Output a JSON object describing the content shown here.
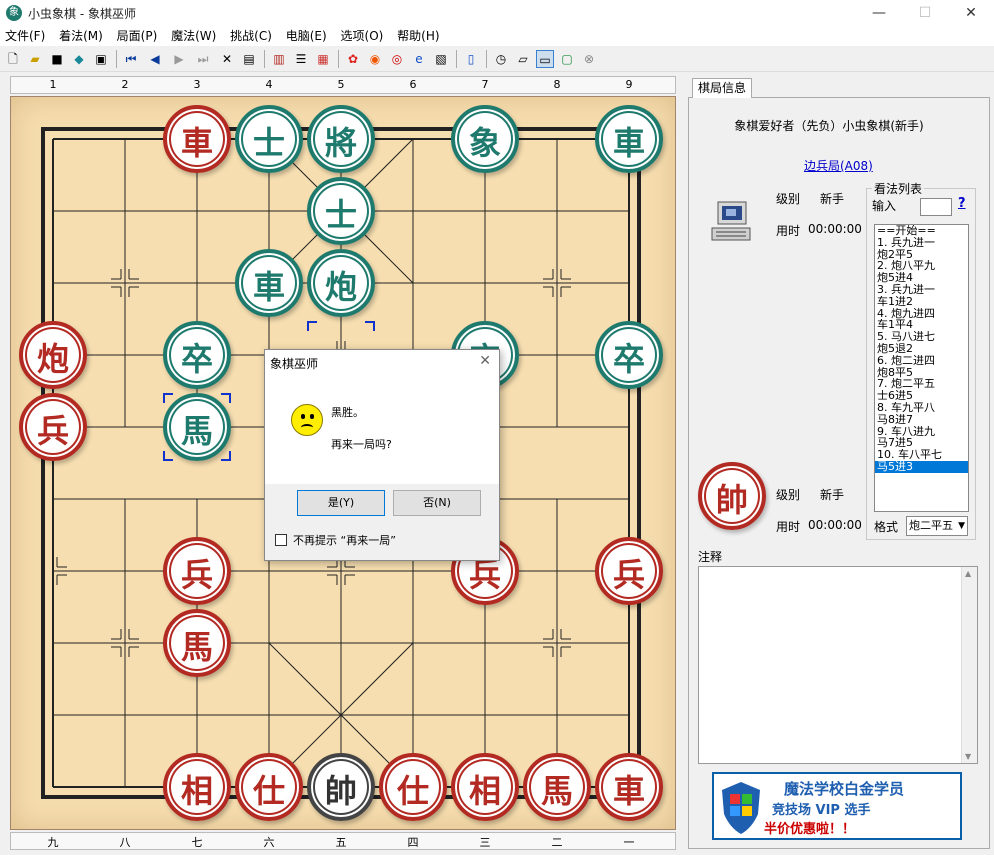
{
  "window": {
    "title": "小虫象棋 - 象棋巫师",
    "app_icon_char": "象",
    "controls": {
      "minimize": "—",
      "maximize": "☐",
      "close": "✕"
    }
  },
  "menu": [
    "文件(F)",
    "着法(M)",
    "局面(P)",
    "魔法(W)",
    "挑战(C)",
    "电脑(E)",
    "选项(O)",
    "帮助(H)"
  ],
  "toolbar_icons": [
    "new-file-icon",
    "open-folder-icon",
    "save-icon",
    "edit-board-icon",
    "print-icon",
    "first-move-icon",
    "prev-move-icon",
    "next-move-icon",
    "last-move-icon",
    "delete-icon",
    "paste-icon",
    "book-icon",
    "tree-icon",
    "table-icon",
    "network-icon",
    "weibo-icon",
    "ie-icon",
    "notes-icon",
    "library-icon",
    "clock-icon",
    "stack-icon",
    "computer-icon",
    "monitor-icon",
    "stop-icon"
  ],
  "board": {
    "top_files": [
      "1",
      "2",
      "3",
      "4",
      "5",
      "6",
      "7",
      "8",
      "9"
    ],
    "bottom_files": [
      "九",
      "八",
      "七",
      "六",
      "五",
      "四",
      "三",
      "二",
      "一"
    ],
    "pieces": [
      {
        "char": "車",
        "side": "red",
        "col": 2,
        "row": 0
      },
      {
        "char": "士",
        "side": "green",
        "col": 3,
        "row": 0
      },
      {
        "char": "將",
        "side": "green",
        "col": 4,
        "row": 0
      },
      {
        "char": "象",
        "side": "green",
        "col": 6,
        "row": 0
      },
      {
        "char": "車",
        "side": "green",
        "col": 8,
        "row": 0
      },
      {
        "char": "士",
        "side": "green",
        "col": 4,
        "row": 1
      },
      {
        "char": "車",
        "side": "green",
        "col": 3,
        "row": 2
      },
      {
        "char": "炮",
        "side": "green",
        "col": 4,
        "row": 2
      },
      {
        "char": "炮",
        "side": "red",
        "col": 0,
        "row": 3
      },
      {
        "char": "卒",
        "side": "green",
        "col": 2,
        "row": 3
      },
      {
        "char": "卒",
        "side": "green",
        "col": 6,
        "row": 3
      },
      {
        "char": "卒",
        "side": "green",
        "col": 8,
        "row": 3
      },
      {
        "char": "兵",
        "side": "red",
        "col": 0,
        "row": 4
      },
      {
        "char": "馬",
        "side": "green",
        "col": 2,
        "row": 4
      },
      {
        "char": "兵",
        "side": "red",
        "col": 2,
        "row": 6
      },
      {
        "char": "兵",
        "side": "red",
        "col": 6,
        "row": 6
      },
      {
        "char": "兵",
        "side": "red",
        "col": 8,
        "row": 6
      },
      {
        "char": "馬",
        "side": "red",
        "col": 2,
        "row": 7
      },
      {
        "char": "相",
        "side": "red",
        "col": 2,
        "row": 9
      },
      {
        "char": "仕",
        "side": "red",
        "col": 3,
        "row": 9
      },
      {
        "char": "帥",
        "side": "gray",
        "col": 4,
        "row": 9
      },
      {
        "char": "仕",
        "side": "red",
        "col": 5,
        "row": 9
      },
      {
        "char": "相",
        "side": "red",
        "col": 6,
        "row": 9
      },
      {
        "char": "馬",
        "side": "red",
        "col": 7,
        "row": 9
      },
      {
        "char": "車",
        "side": "red",
        "col": 8,
        "row": 9
      }
    ],
    "selection_marks": [
      {
        "col": 2,
        "row": 4
      },
      {
        "col": 4,
        "row": 3
      }
    ]
  },
  "dialog": {
    "title": "象棋巫师",
    "close": "✕",
    "message1": "黑胜。",
    "message2": "再来一局吗?",
    "yes_label": "是(Y)",
    "no_label": "否(N)",
    "checkbox_label": "不再提示 “再来一局”"
  },
  "info": {
    "tab_label": "棋局信息",
    "players": "象棋爱好者（先负）小虫象棋(新手)",
    "opening": "边兵局(A08)",
    "top_player": {
      "level_label": "级别",
      "level": "新手",
      "time_label": "用时",
      "time": "00:00:00"
    },
    "bottom_player": {
      "king_char": "帥",
      "level_label": "级别",
      "level": "新手",
      "time_label": "用时",
      "time": "00:00:00"
    },
    "moves_title": "看法列表",
    "input_label": "输入",
    "help": "?",
    "moves": [
      "==开始==",
      "1. 兵九进一",
      "   炮2平5",
      "2. 炮八平九",
      "   炮5进4",
      "3. 兵九进一",
      "   车1进2",
      "4. 炮九进四",
      "   车1平4",
      "5. 马八进七",
      "   炮5退2",
      "6. 炮二进四",
      "   炮8平5",
      "7. 炮二平五",
      "   士6进5",
      "8. 车九平八",
      "   马8进7",
      "9. 车八进九",
      "   马7进5",
      "10. 车八平七",
      "   马5进3"
    ],
    "selected_move_index": 20,
    "format_label": "格式",
    "format_value": "炮二平五",
    "note_label": "注释"
  },
  "ad": {
    "line1": "魔法学校白金学员",
    "line2": "竞技场 VIP 选手",
    "line3": "半价优惠啦！！"
  }
}
